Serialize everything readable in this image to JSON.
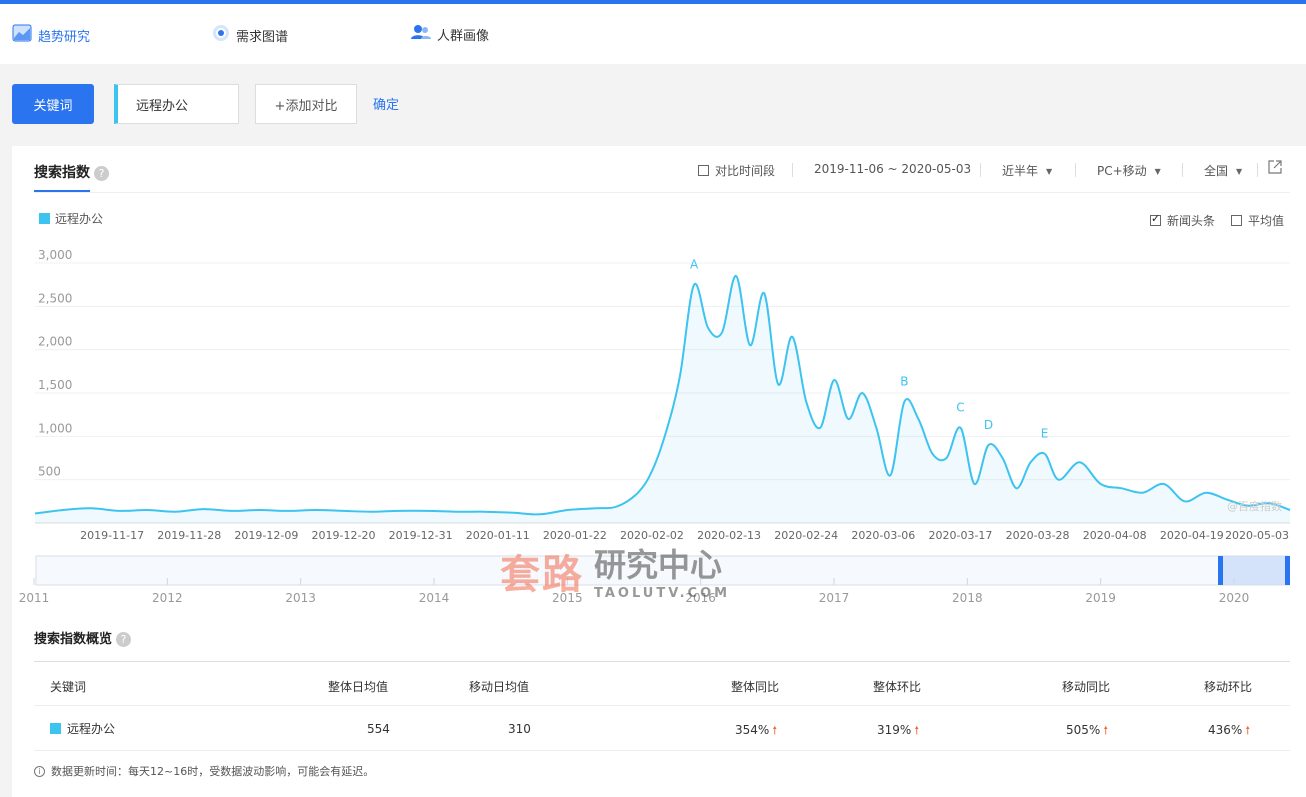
{
  "nav": {
    "items": [
      {
        "label": "趋势研究",
        "icon": "trend-icon",
        "active": true
      },
      {
        "label": "需求图谱",
        "icon": "radar-icon",
        "active": false
      },
      {
        "label": "人群画像",
        "icon": "people-icon",
        "active": false
      }
    ]
  },
  "search": {
    "keyword_button": "关键词",
    "keyword_value": "远程办公",
    "add_compare": "+添加对比",
    "confirm": "确定"
  },
  "panel": {
    "tab_title": "搜索指数",
    "compare_period": "对比时间段",
    "date_range": "2019-11-06 ~ 2020-05-03",
    "period": "近半年",
    "device": "PC+移动",
    "region": "全国",
    "news_headline": "新闻头条",
    "average": "平均值",
    "news_checked": true,
    "average_checked": false
  },
  "colors": {
    "accent": "#2a74f0",
    "series": "#3cc3f0",
    "up_arrow": "#f06a3c"
  },
  "chart_data": {
    "type": "area",
    "legend": [
      "远程办公"
    ],
    "watermark": "@百度指数",
    "ylim": [
      0,
      3000
    ],
    "y_ticks": [
      "3,000",
      "2,500",
      "2,000",
      "1,500",
      "1,000",
      "500"
    ],
    "x_ticks": [
      "2019-11-17",
      "2019-11-28",
      "2019-12-09",
      "2019-12-20",
      "2019-12-31",
      "2020-01-11",
      "2020-01-22",
      "2020-02-02",
      "2020-02-13",
      "2020-02-24",
      "2020-03-06",
      "2020-03-17",
      "2020-03-28",
      "2020-04-08",
      "2020-04-19",
      "2020-05-03"
    ],
    "series": [
      {
        "name": "远程办公",
        "x": [
          "2019-11-06",
          "2019-11-10",
          "2019-11-14",
          "2019-11-18",
          "2019-11-22",
          "2019-11-26",
          "2019-11-30",
          "2019-12-04",
          "2019-12-08",
          "2019-12-12",
          "2019-12-16",
          "2019-12-20",
          "2019-12-24",
          "2019-12-28",
          "2020-01-01",
          "2020-01-05",
          "2020-01-09",
          "2020-01-13",
          "2020-01-17",
          "2020-01-21",
          "2020-01-25",
          "2020-01-28",
          "2020-01-31",
          "2020-02-02",
          "2020-02-04",
          "2020-02-06",
          "2020-02-08",
          "2020-02-10",
          "2020-02-12",
          "2020-02-14",
          "2020-02-16",
          "2020-02-18",
          "2020-02-20",
          "2020-02-22",
          "2020-02-24",
          "2020-02-26",
          "2020-02-28",
          "2020-03-01",
          "2020-03-03",
          "2020-03-05",
          "2020-03-07",
          "2020-03-09",
          "2020-03-11",
          "2020-03-13",
          "2020-03-15",
          "2020-03-17",
          "2020-03-19",
          "2020-03-21",
          "2020-03-23",
          "2020-03-25",
          "2020-03-27",
          "2020-03-29",
          "2020-03-31",
          "2020-04-03",
          "2020-04-06",
          "2020-04-09",
          "2020-04-12",
          "2020-04-15",
          "2020-04-18",
          "2020-04-21",
          "2020-04-24",
          "2020-04-27",
          "2020-04-30",
          "2020-05-03"
        ],
        "values": [
          110,
          150,
          170,
          140,
          150,
          130,
          160,
          140,
          150,
          140,
          150,
          140,
          130,
          140,
          140,
          130,
          130,
          120,
          100,
          150,
          170,
          190,
          350,
          600,
          1050,
          1700,
          2750,
          2250,
          2200,
          2850,
          2050,
          2650,
          1600,
          2150,
          1400,
          1100,
          1650,
          1200,
          1500,
          1100,
          550,
          1400,
          1200,
          800,
          750,
          1100,
          450,
          900,
          750,
          400,
          700,
          800,
          500,
          700,
          450,
          400,
          350,
          450,
          250,
          350,
          270,
          200,
          230,
          150
        ]
      }
    ],
    "annotations": [
      {
        "label": "A",
        "x": "2020-02-08"
      },
      {
        "label": "B",
        "x": "2020-03-09"
      },
      {
        "label": "C",
        "x": "2020-03-17"
      },
      {
        "label": "D",
        "x": "2020-03-21"
      },
      {
        "label": "E",
        "x": "2020-03-29"
      }
    ],
    "range_selector_years": [
      "2011",
      "2012",
      "2013",
      "2014",
      "2015",
      "2016",
      "2017",
      "2018",
      "2019",
      "2020"
    ]
  },
  "overview": {
    "title": "搜索指数概览",
    "headers": [
      "关键词",
      "整体日均值",
      "移动日均值",
      "整体同比",
      "整体环比",
      "移动同比",
      "移动环比"
    ],
    "row": {
      "keyword": "远程办公",
      "overall_avg": "554",
      "mobile_avg": "310",
      "overall_yoy": "354%",
      "overall_mom": "319%",
      "mobile_yoy": "505%",
      "mobile_mom": "436%"
    },
    "up_arrow": "🠕"
  },
  "note": "数据更新时间：每天12~16时，受数据波动影响，可能会有延迟。",
  "watermark_overlay": {
    "big": "套路",
    "cn": "研究中心",
    "en": "TAOLUTV.COM"
  }
}
